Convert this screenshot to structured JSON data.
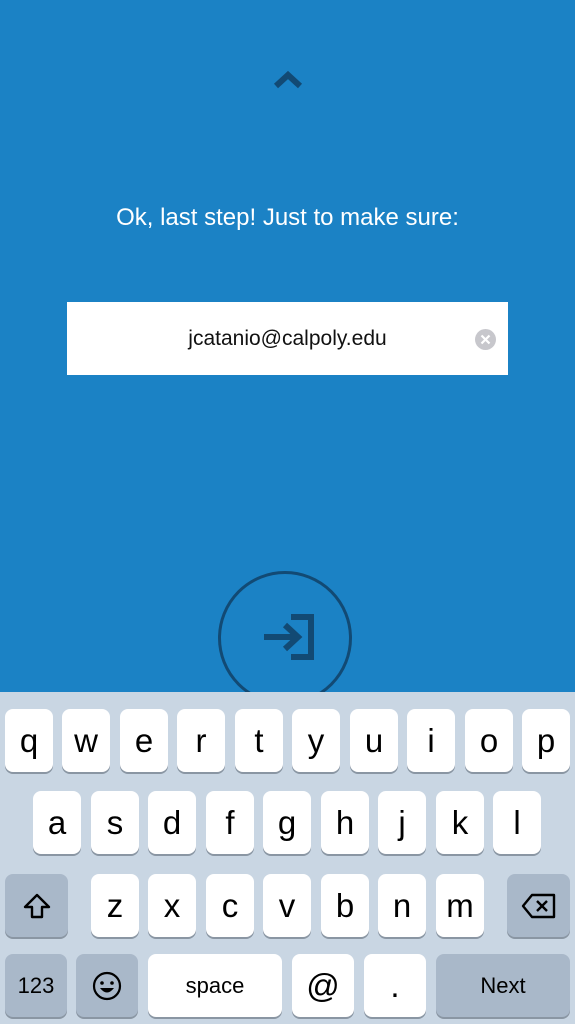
{
  "header": {
    "chevron_icon": "chevron-up-icon"
  },
  "prompt": "Ok, last step! Just to make sure:",
  "email_field": {
    "value": "jcatanio@calpoly.edu",
    "clear_icon": "clear-icon"
  },
  "submit_icon": "sign-in-arrow-icon",
  "colors": {
    "background": "#1b82c5",
    "accent_dark": "#124a74",
    "keyboard_bg": "#c9d6e3"
  },
  "keyboard": {
    "row1": [
      "q",
      "w",
      "e",
      "r",
      "t",
      "y",
      "u",
      "i",
      "o",
      "p"
    ],
    "row2": [
      "a",
      "s",
      "d",
      "f",
      "g",
      "h",
      "j",
      "k",
      "l"
    ],
    "row3": [
      "z",
      "x",
      "c",
      "v",
      "b",
      "n",
      "m"
    ],
    "numbers_label": "123",
    "space_label": "space",
    "at_label": "@",
    "dot_label": ".",
    "next_label": "Next"
  }
}
